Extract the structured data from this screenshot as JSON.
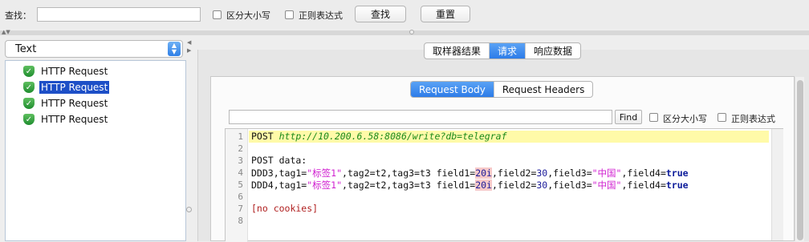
{
  "search": {
    "label": "查找：",
    "case_sensitive_label": "区分大小写",
    "regex_label": "正则表达式",
    "find_button": "查找",
    "reset_button": "重置"
  },
  "left": {
    "renderer_select": "Text",
    "tree_items": [
      "HTTP Request",
      "HTTP Request",
      "HTTP Request",
      "HTTP Request"
    ]
  },
  "result_tabs": [
    "取样器结果",
    "请求",
    "响应数据"
  ],
  "request_tabs": [
    "Request Body",
    "Request Headers"
  ],
  "inner_search": {
    "find_button": "Find",
    "case_sensitive_label": "区分大小写",
    "regex_label": "正则表达式"
  },
  "editor": {
    "line_numbers": [
      "1",
      "2",
      "3",
      "4",
      "5",
      "6",
      "7",
      "8"
    ],
    "line1": {
      "method": "POST ",
      "url": "http://10.200.6.58:8086/write?db=telegraf"
    },
    "line3": "POST data:",
    "line4": {
      "a": "DDD3,tag1=",
      "s1": "\"标签1\"",
      "b": ",tag2=t2,tag3=t3 field1=",
      "n1": "20i",
      "c": ",field2=",
      "n2": "30",
      "d": ",field3=",
      "s2": "\"中国\"",
      "e": ",field4=",
      "kw": "true"
    },
    "line5": {
      "a": "DDD4,tag1=",
      "s1": "\"标签1\"",
      "b": ",tag2=t2,tag3=t3 field1=",
      "n1": "20i",
      "c": ",field2=",
      "n2": "30",
      "d": ",field3=",
      "s2": "\"中国\"",
      "e": ",field4=",
      "kw": "true"
    },
    "line7": "[no cookies]"
  },
  "colors": {
    "selected_tab": "#2d7ce8",
    "tree_selection": "#1d4fc7",
    "highlight_line": "#fffaa8",
    "string": "#d01fd0"
  }
}
